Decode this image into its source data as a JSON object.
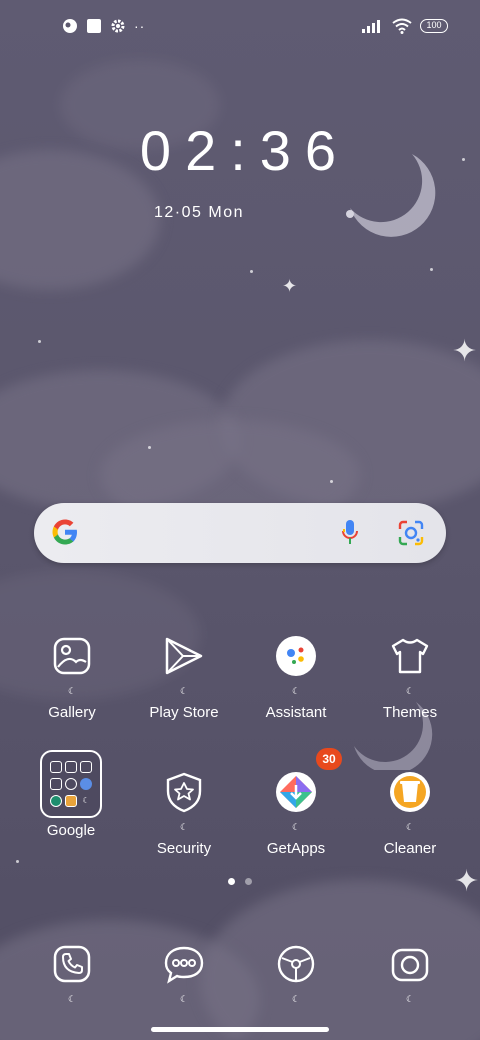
{
  "status_bar": {
    "battery_level": "100",
    "left_icons": [
      "app-notification-icon",
      "square-notification-icon",
      "settings-gear-icon",
      "more-dots-icon"
    ],
    "right_icons": [
      "signal-icon",
      "wifi-icon",
      "battery-icon"
    ]
  },
  "clock": {
    "time": "02:36",
    "date": "12·05  Mon"
  },
  "search": {
    "icons": [
      "google-g-icon",
      "mic-icon",
      "lens-icon"
    ]
  },
  "apps": {
    "gallery": {
      "label": "Gallery",
      "icon": "gallery-icon"
    },
    "play_store": {
      "label": "Play Store",
      "icon": "play-store-icon"
    },
    "assistant": {
      "label": "Assistant",
      "icon": "assistant-icon"
    },
    "themes": {
      "label": "Themes",
      "icon": "themes-icon"
    },
    "google": {
      "label": "Google",
      "icon": "folder-icon"
    },
    "security": {
      "label": "Security",
      "icon": "security-icon"
    },
    "getapps": {
      "label": "GetApps",
      "icon": "getapps-icon",
      "badge": "30"
    },
    "cleaner": {
      "label": "Cleaner",
      "icon": "cleaner-icon"
    }
  },
  "page_indicator": {
    "pages": 2,
    "active": 1
  },
  "dock": [
    {
      "icon": "phone-icon"
    },
    {
      "icon": "messages-icon"
    },
    {
      "icon": "browser-icon"
    },
    {
      "icon": "camera-icon"
    }
  ],
  "colors": {
    "background": "#5b576d",
    "badge": "#e8491d",
    "search_bar": "#ececf0"
  }
}
